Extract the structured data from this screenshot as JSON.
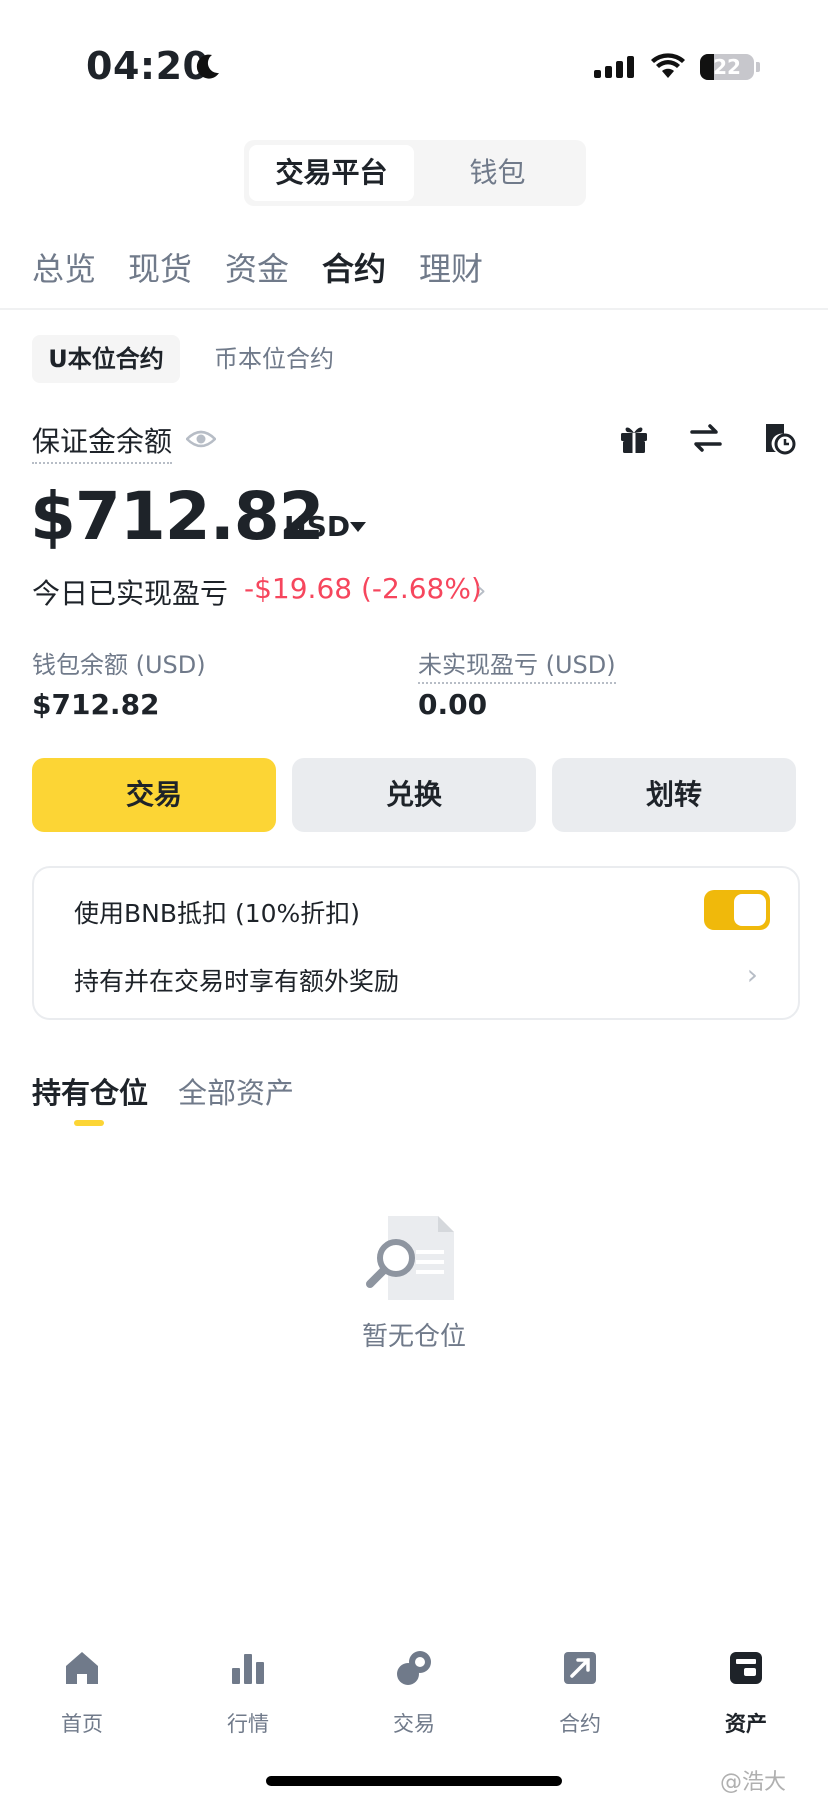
{
  "status_bar": {
    "time": "04:20",
    "battery": "22"
  },
  "segment": {
    "active": "交易平台",
    "inactive": "钱包"
  },
  "main_tabs": [
    "总览",
    "现货",
    "资金",
    "合约",
    "理财"
  ],
  "sub_tabs": {
    "active": "U本位合约",
    "inactive": "币本位合约"
  },
  "margin": {
    "label": "保证金余额",
    "balance": "$712.82",
    "currency": "USD",
    "pnl_label": "今日已实现盈亏",
    "pnl_value": "-$19.68 (-2.68%)"
  },
  "stats": {
    "wallet_label": "钱包余额 (USD)",
    "wallet_value": "$712.82",
    "unrealized_label": "未实现盈亏 (USD)",
    "unrealized_value": "0.00"
  },
  "actions": {
    "trade": "交易",
    "convert": "兑换",
    "transfer": "划转"
  },
  "bnb_card": {
    "row1": "使用BNB抵扣 (10%折扣)",
    "row2": "持有并在交易时享有额外奖励",
    "toggle_on": true
  },
  "position_tabs": {
    "active": "持有仓位",
    "inactive": "全部资产"
  },
  "empty": {
    "text": "暂无仓位"
  },
  "bottom_nav": [
    {
      "label": "首页",
      "icon": "home-icon"
    },
    {
      "label": "行情",
      "icon": "market-icon"
    },
    {
      "label": "交易",
      "icon": "trade-icon"
    },
    {
      "label": "合约",
      "icon": "futures-icon"
    },
    {
      "label": "资产",
      "icon": "wallet-icon"
    }
  ],
  "watermark": "@浩大",
  "colors": {
    "accent": "#fcd535",
    "negative": "#f6465d",
    "toggle": "#f0b90b"
  }
}
